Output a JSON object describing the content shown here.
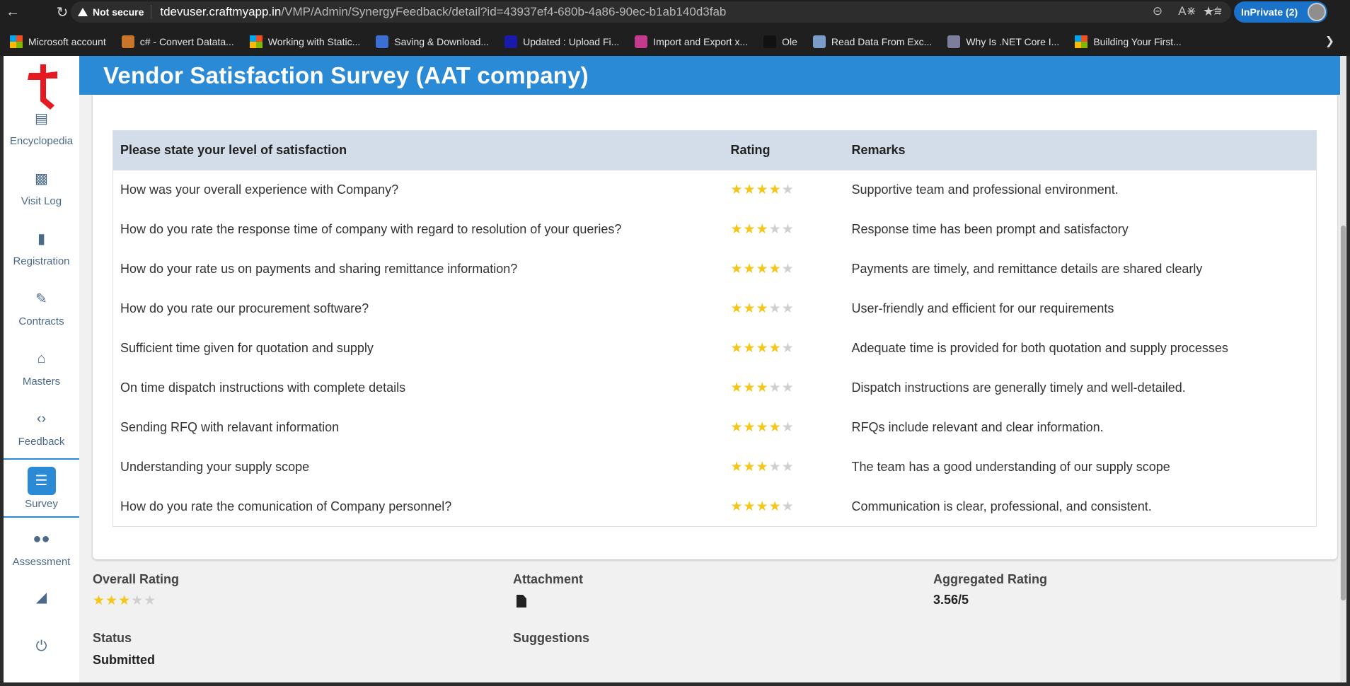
{
  "browser": {
    "not_secure": "Not secure",
    "url_host": "tdevuser.craftmyapp.in",
    "url_path": "/VMP/Admin/SynergyFeedback/detail?id=43937ef4-680b-4a86-90ec-b1ab140d3fab",
    "inprivate": "InPrivate (2)",
    "bookmarks": [
      "Microsoft account",
      "c# - Convert Datata...",
      "Working with Static...",
      "Saving & Download...",
      "Updated : Upload Fi...",
      "Import and Export x...",
      "Ole",
      "Read Data From Exc...",
      "Why Is .NET Core I...",
      "Building Your First..."
    ]
  },
  "sidebar": {
    "items": [
      {
        "label": "Encyclopedia",
        "icon": "newspaper-icon"
      },
      {
        "label": "Visit Log",
        "icon": "inbox-icon"
      },
      {
        "label": "Registration",
        "icon": "file-icon"
      },
      {
        "label": "Contracts",
        "icon": "edit-icon"
      },
      {
        "label": "Masters",
        "icon": "home-icon"
      },
      {
        "label": "Feedback",
        "icon": "file-code-icon"
      },
      {
        "label": "Survey",
        "icon": "database-icon"
      },
      {
        "label": "Assessment",
        "icon": "users-icon"
      },
      {
        "label": "",
        "icon": "chart-icon"
      },
      {
        "label": "",
        "icon": "power-icon"
      }
    ]
  },
  "page": {
    "title": "Vendor Satisfaction Survey (AAT company)"
  },
  "table": {
    "headers": [
      "Please state your level of satisfaction",
      "Rating",
      "Remarks"
    ],
    "rows": [
      {
        "question": "How was your overall experience with Company?",
        "rating": 4,
        "remark": "Supportive team and professional environment."
      },
      {
        "question": "How do you rate the response time of company with regard to resolution of your queries?",
        "rating": 3,
        "remark": "Response time has been prompt and satisfactory"
      },
      {
        "question": "How do your rate us on payments and sharing remittance information?",
        "rating": 4,
        "remark": "Payments are timely, and remittance details are shared clearly"
      },
      {
        "question": "How do you rate our procurement software?",
        "rating": 3,
        "remark": "User-friendly and efficient for our requirements"
      },
      {
        "question": "Sufficient time given for quotation and supply",
        "rating": 4,
        "remark": "Adequate time is provided for both quotation and supply processes"
      },
      {
        "question": "On time dispatch instructions with complete details",
        "rating": 3,
        "remark": "Dispatch instructions are generally timely and well-detailed."
      },
      {
        "question": "Sending RFQ with relavant information",
        "rating": 4,
        "remark": "RFQs include relevant and clear information."
      },
      {
        "question": "Understanding your supply scope",
        "rating": 3,
        "remark": "The team has a good understanding of our supply scope"
      },
      {
        "question": "How do you rate the comunication of Company personnel?",
        "rating": 4,
        "remark": "Communication is clear, professional, and consistent."
      }
    ],
    "max_rating": 5
  },
  "summary": {
    "overall_label": "Overall Rating",
    "overall_rating": 3,
    "attachment_label": "Attachment",
    "aggregated_label": "Aggregated Rating",
    "aggregated_value": "3.56/5",
    "status_label": "Status",
    "status_value": "Submitted",
    "suggestions_label": "Suggestions"
  },
  "colors": {
    "accent": "#2b8ad6",
    "star_on": "#f5c518",
    "star_off": "#d0d0d0",
    "logo": "#e5191f"
  }
}
